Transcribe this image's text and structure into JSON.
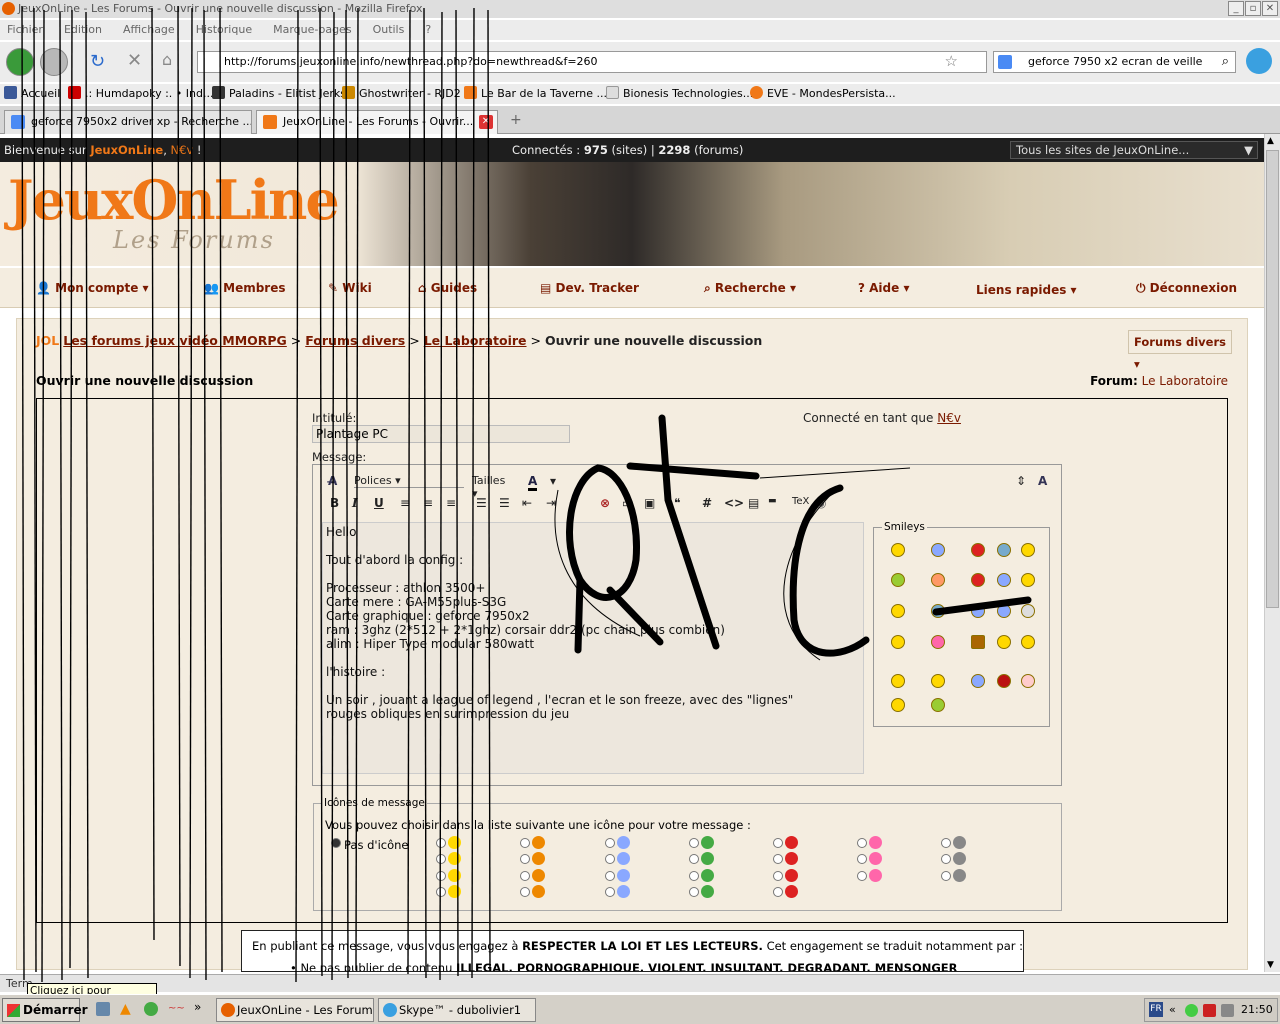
{
  "window": {
    "title": "JeuxOnLine - Les Forums - Ouvrir une nouvelle discussion - Mozilla Firefox"
  },
  "menu": [
    "Fichier",
    "Edition",
    "Affichage",
    "Historique",
    "Marque-pages",
    "Outils",
    "?"
  ],
  "nav": {
    "url": "http://forums.jeuxonline.info/newthread.php?do=newthread&f=260",
    "search": "geforce 7950 x2 ecran de veille"
  },
  "bookmarks": [
    "Accueil",
    ".: Humdapoky :. • Ind...",
    "Paladins - Elitist Jerks",
    "Ghostwriter - RJD2",
    "Le Bar de la Taverne ...",
    "Bionesis Technologies...",
    "EVE - MondesPersista..."
  ],
  "tabs": [
    "geforce 7950x2 driver xp - Recherche ...",
    "JeuxOnLine - Les Forums - Ouvrir..."
  ],
  "jol": {
    "welcome": "Bienvenue sur",
    "brand": "JeuxOnLine",
    "user": "N€v",
    "connected_label": "Connectés :",
    "sites_count": "975",
    "sites_label": "(sites) |",
    "forums_count": "2298",
    "forums_label": "(forums)",
    "all_sites": "Tous les sites de JeuxOnLine..."
  },
  "banner": {
    "logo": "JeuxOnLine",
    "subtitle": "Les Forums"
  },
  "mainnav": [
    "Mon compte",
    "Membres",
    "Wiki",
    "Guides",
    "Dev. Tracker",
    "Recherche",
    "Aide",
    "Liens rapides",
    "Déconnexion"
  ],
  "breadcrumb": {
    "items": [
      "Les forums jeux vidéo MMORPG",
      "Forums divers",
      "Le Laboratoire"
    ],
    "sep": ">",
    "current": "Ouvrir une nouvelle discussion",
    "forums_divers": "Forums divers"
  },
  "form": {
    "heading": "Ouvrir une nouvelle discussion",
    "forum_label": "Forum:",
    "forum_name": "Le Laboratoire",
    "title_label": "Intitulé:",
    "title_value": "Plantage PC",
    "logged_as": "Connecté en tant que",
    "logged_user": "N€v",
    "message_label": "Message:",
    "font_select": "Polices",
    "size_select": "Tailles",
    "smileys_label": "Smileys",
    "message_text": "Hello\n\nTout d'abord la config :\n\nProcesseur : athlon 3500+\nCarte mere : GA-M55plus-S3G\nCarte graphique : geforce 7950x2\nram : 3ghz (2*512 + 2*1ghz) corsair ddr2 (pc chain plus combien)\nalim : Hiper Type modular 580watt\n\nl'histoire :\n\nUn soir , jouant a league of legend , l'ecran et le son freeze, avec des \"lignes\"\nrouges obliques en surimpression du jeu",
    "icons_legend": "Icônes de message",
    "icons_intro": "Vous pouvez choisir dans la liste suivante une icône pour votre message :",
    "no_icon": "Pas d'icône"
  },
  "legal": {
    "line1_a": "En publiant ce message, vous vous engagez à",
    "line1_b": "RESPECTER LA LOI ET LES LECTEURS.",
    "line1_c": "Cet engagement se traduit notamment par :",
    "line2_a": "Ne pas publier de contenu",
    "line2_b": "ILLEGAL, PORNOGRAPHIQUE, VIOLENT, INSULTANT, DEGRADANT, MENSONGER"
  },
  "status": {
    "text": "Term",
    "tooltip": "Cliquez ici pour commencer"
  },
  "taskbar": {
    "start": "Démarrer",
    "tasks": [
      "JeuxOnLine - Les Forums...",
      "Skype™ - dubolivier1"
    ],
    "lang": "FR",
    "time": "21:50"
  },
  "scribble_text": "QTC",
  "colors": {
    "jol_orange": "#f07818",
    "link_red": "#7a1a00",
    "page_bg": "#f4ede0"
  }
}
